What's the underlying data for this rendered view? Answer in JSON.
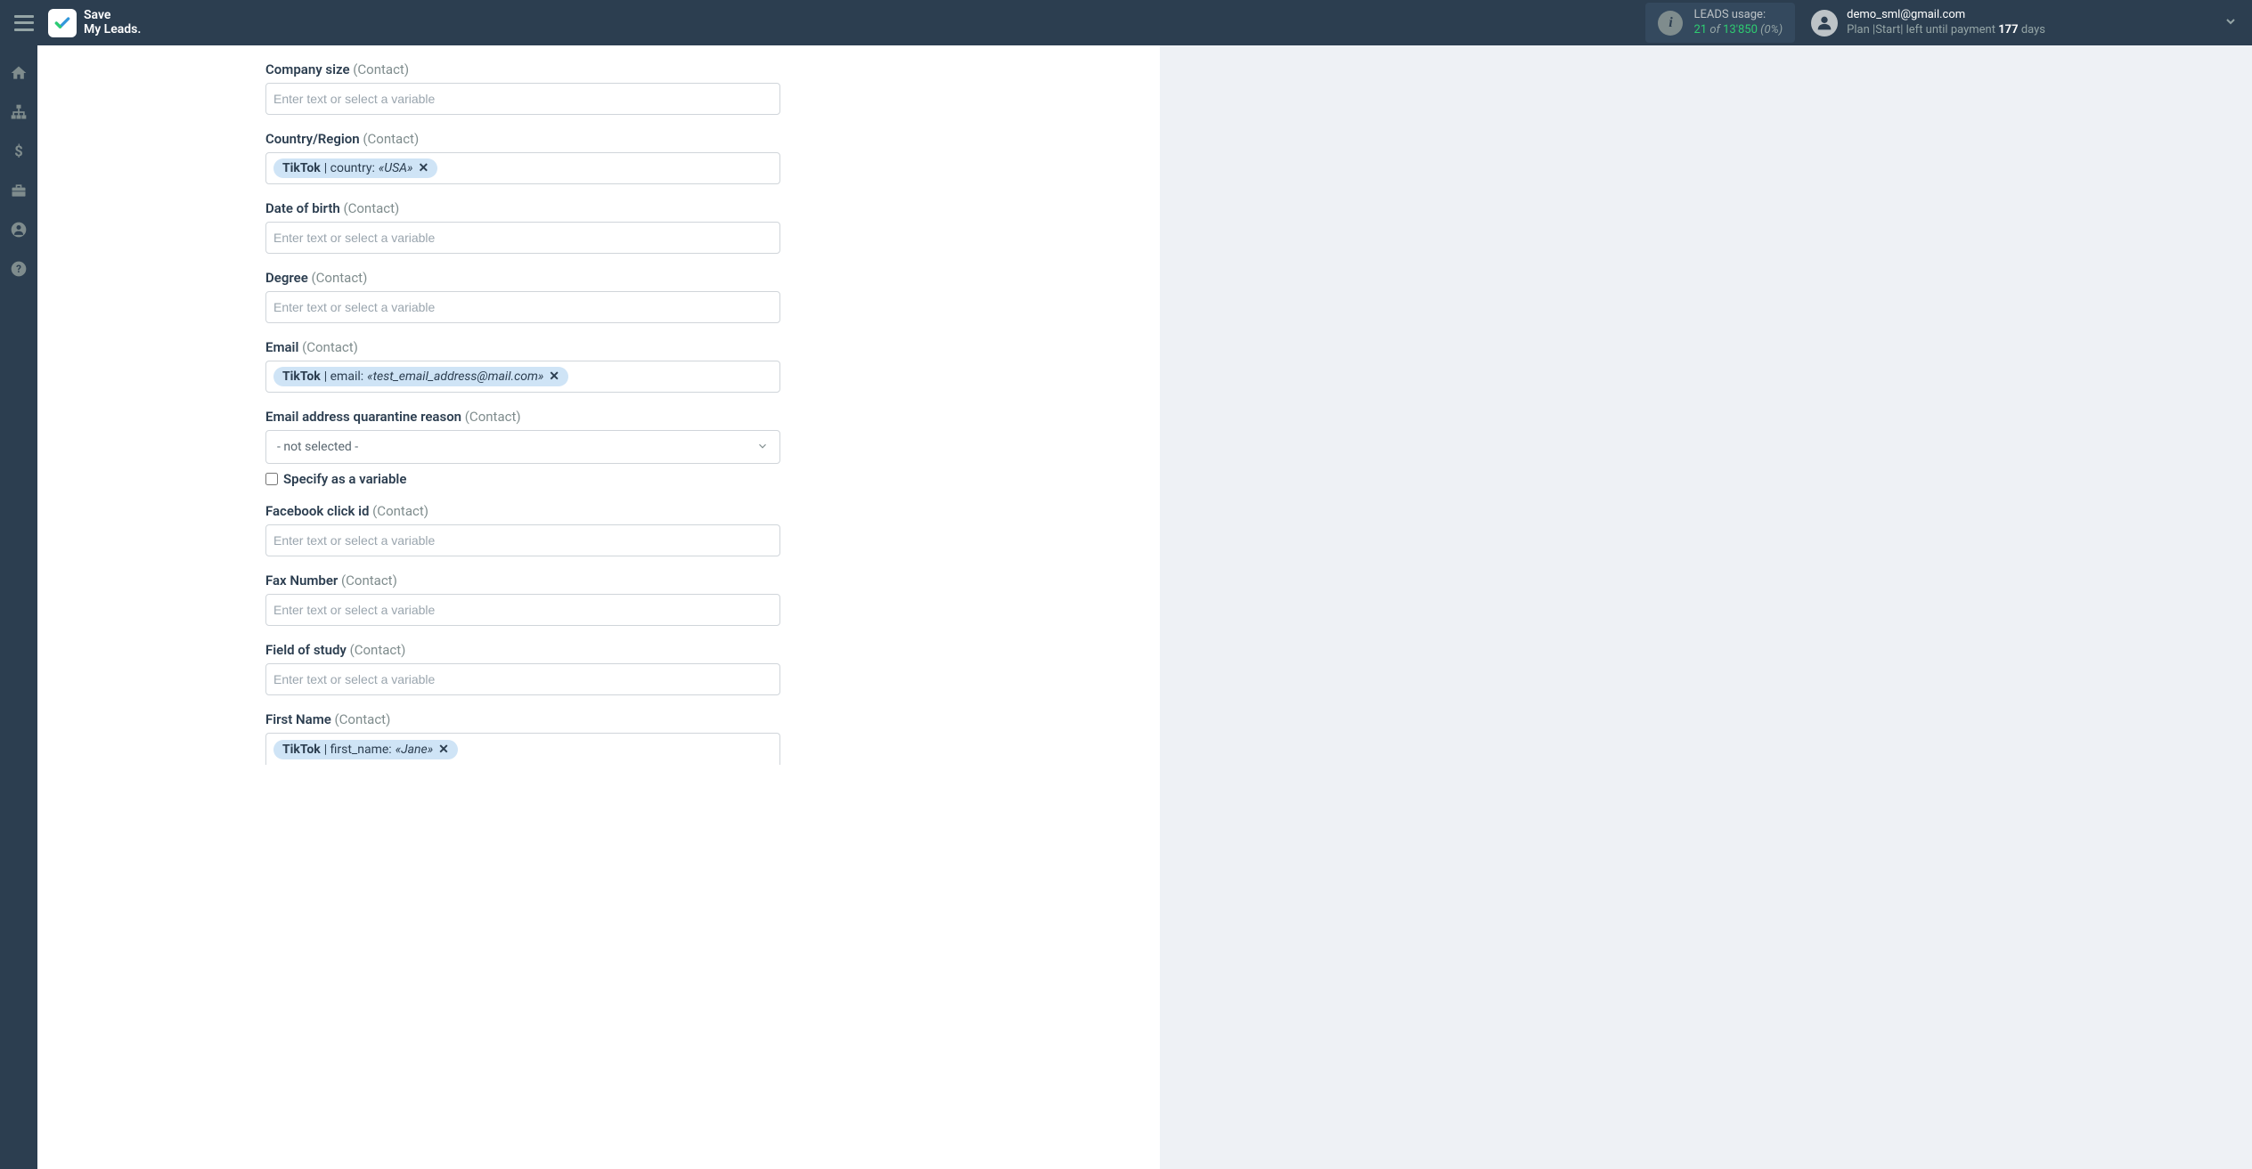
{
  "header": {
    "logo_line1": "Save",
    "logo_line2": "My Leads.",
    "usage_label": "LEADS usage:",
    "usage_current": "21",
    "usage_of": "of",
    "usage_total": "13'850",
    "usage_pct": "(0%)",
    "user_email": "demo_sml@gmail.com",
    "plan_prefix": "Plan |",
    "plan_name": "Start",
    "plan_middle": "| left until payment ",
    "plan_days": "177",
    "plan_suffix": " days"
  },
  "form": {
    "placeholder": "Enter text or select a variable",
    "fields": [
      {
        "label": "Company size",
        "suffix": "(Contact)",
        "type": "text"
      },
      {
        "label": "Country/Region",
        "suffix": "(Contact)",
        "type": "pill",
        "pill_source": "TikTok",
        "pill_field": "country:",
        "pill_value": "«USA»"
      },
      {
        "label": "Date of birth",
        "suffix": "(Contact)",
        "type": "text"
      },
      {
        "label": "Degree",
        "suffix": "(Contact)",
        "type": "text"
      },
      {
        "label": "Email",
        "suffix": "(Contact)",
        "type": "pill",
        "pill_source": "TikTok",
        "pill_field": "email:",
        "pill_value": "«test_email_address@mail.com»"
      },
      {
        "label": "Email address quarantine reason",
        "suffix": "(Contact)",
        "type": "select",
        "select_value": "- not selected -",
        "checkbox_label": "Specify as a variable"
      },
      {
        "label": "Facebook click id",
        "suffix": "(Contact)",
        "type": "text"
      },
      {
        "label": "Fax Number",
        "suffix": "(Contact)",
        "type": "text"
      },
      {
        "label": "Field of study",
        "suffix": "(Contact)",
        "type": "text"
      },
      {
        "label": "First Name",
        "suffix": "(Contact)",
        "type": "pill_cut",
        "pill_source": "TikTok",
        "pill_field": "first_name:",
        "pill_value": "«Jane»"
      }
    ]
  }
}
